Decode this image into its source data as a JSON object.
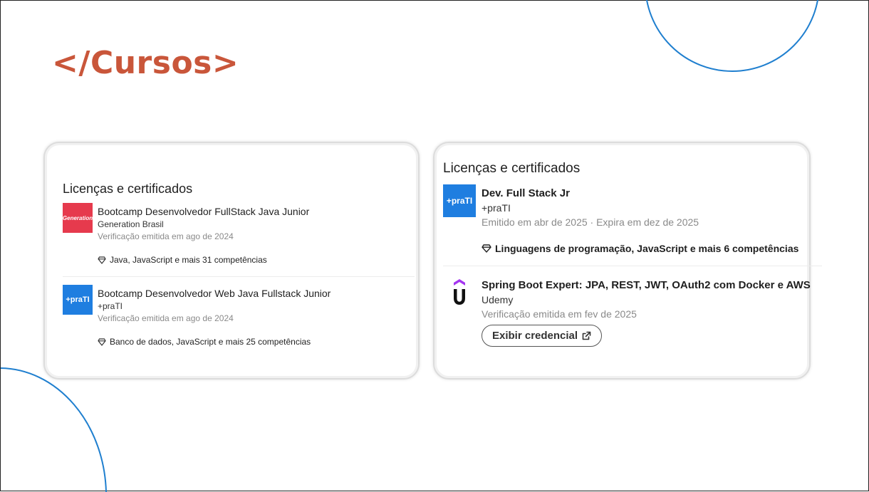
{
  "page": {
    "title": "</Cursos>",
    "accent_color": "#c9563a",
    "decor_color": "#1f7fcf"
  },
  "left_card": {
    "heading": "Licenças e certificados",
    "entries": [
      {
        "logo_icon": "generation-brasil-logo",
        "logo_text": "Generation",
        "title": "Bootcamp Desenvolvedor FullStack Java Junior",
        "issuer": "Generation Brasil",
        "meta": "Verificação emitida em ago de 2024",
        "skills_icon": "diamond-icon",
        "skills": "Java, JavaScript e mais 31 competências"
      },
      {
        "logo_icon": "prati-logo",
        "logo_text": "+praTI",
        "title": "Bootcamp Desenvolvedor Web Java Fullstack Junior",
        "issuer": "+praTI",
        "meta": "Verificação emitida em ago de 2024",
        "skills_icon": "diamond-icon",
        "skills": "Banco de dados, JavaScript e mais 25 competências"
      }
    ]
  },
  "right_card": {
    "heading": "Licenças e certificados",
    "entries": [
      {
        "logo_icon": "prati-logo",
        "logo_text": "+praTI",
        "title": "Dev. Full Stack Jr",
        "issuer": "+praTI",
        "meta": "Emitido em abr de 2025 · Expira em dez de 2025",
        "skills_icon": "diamond-icon",
        "skills": "Linguagens de programação, JavaScript e mais 6 competências"
      },
      {
        "logo_icon": "udemy-logo",
        "title": "Spring Boot Expert: JPA, REST, JWT, OAuth2 com Docker e AWS",
        "issuer": "Udemy",
        "meta": "Verificação emitida em fev de 2025",
        "button_label": "Exibir credencial",
        "button_icon": "external-link-icon"
      }
    ]
  }
}
